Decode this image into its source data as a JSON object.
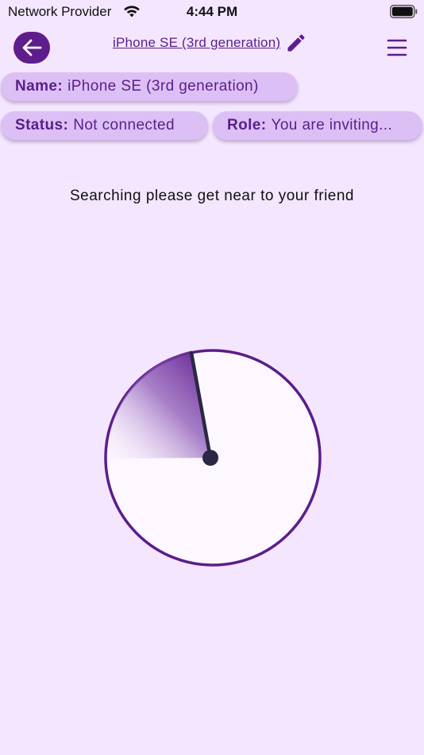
{
  "status_bar": {
    "carrier": "Network Provider",
    "time": "4:44 PM"
  },
  "header": {
    "device_title": "iPhone SE (3rd generation)",
    "icons": {
      "back": "arrow-left-icon",
      "edit": "pencil-icon",
      "menu": "menu-icon"
    }
  },
  "chips": {
    "name": {
      "label": "Name:",
      "value": "iPhone SE (3rd generation)"
    },
    "status": {
      "label": "Status:",
      "value": "Not connected"
    },
    "role": {
      "label": "Role:",
      "value": "You are inviting..."
    }
  },
  "main": {
    "searching_text": "Searching please get near to your friend"
  },
  "colors": {
    "background": "#f4e6fe",
    "accent": "#5e1d8d",
    "chip": "#dcc0f5",
    "needle": "#2b2745"
  }
}
